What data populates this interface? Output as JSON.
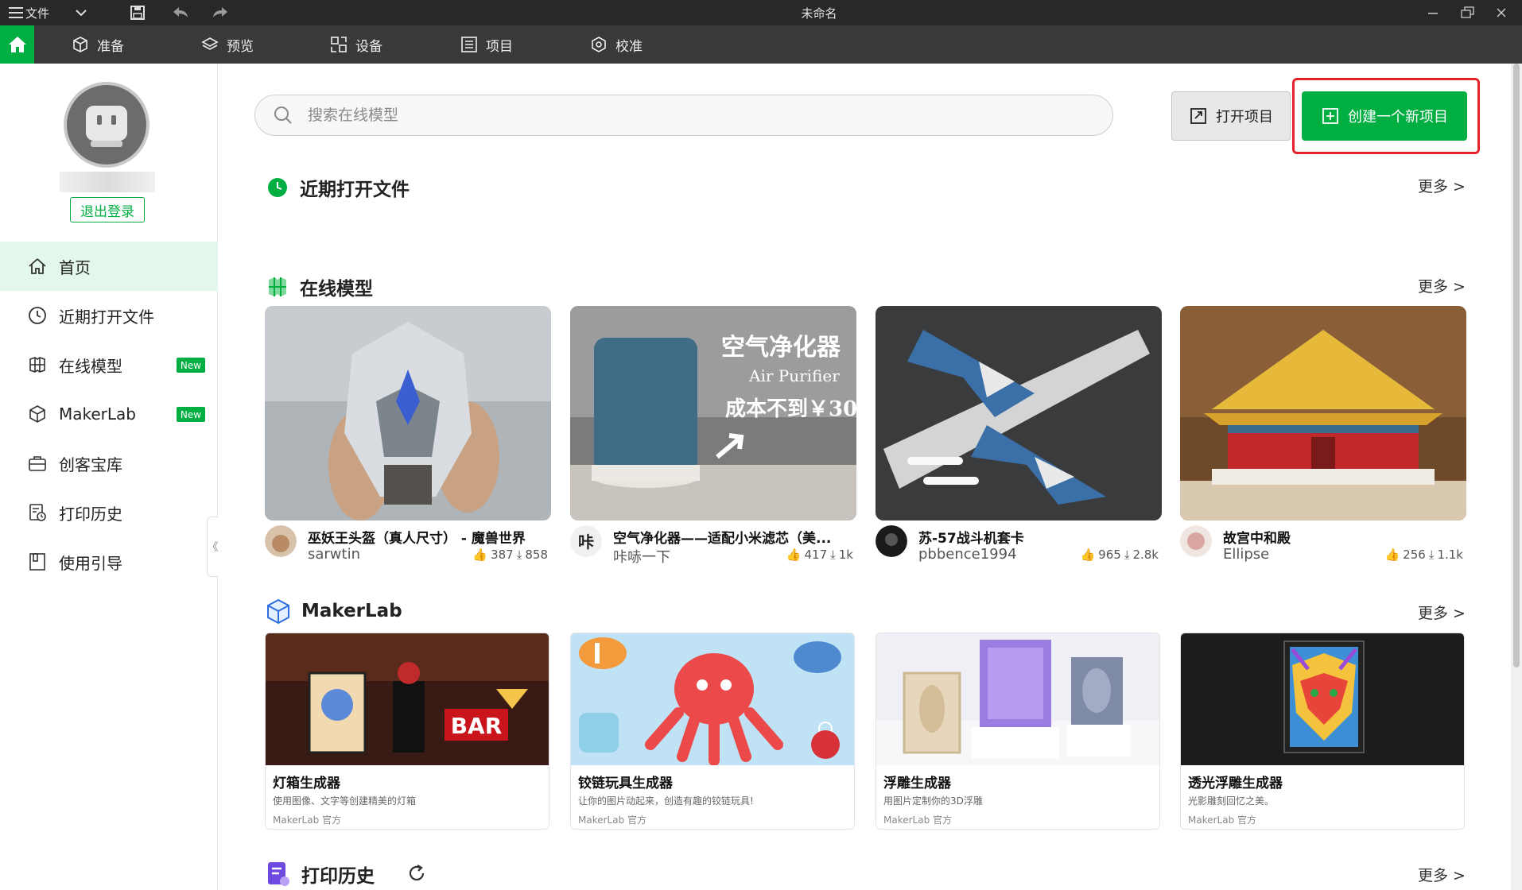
{
  "titlebar": {
    "menu_label": "文件",
    "doc_title": "未命名"
  },
  "tabs": [
    {
      "label": "准备",
      "icon": "cube-icon"
    },
    {
      "label": "预览",
      "icon": "layers-icon"
    },
    {
      "label": "设备",
      "icon": "device-icon"
    },
    {
      "label": "项目",
      "icon": "project-icon"
    },
    {
      "label": "校准",
      "icon": "calibrate-icon"
    }
  ],
  "sidebar": {
    "logout": "退出登录",
    "items": [
      {
        "label": "首页",
        "icon": "home-icon"
      },
      {
        "label": "近期打开文件",
        "icon": "clock-icon"
      },
      {
        "label": "在线模型",
        "icon": "models-icon",
        "badge": "New"
      },
      {
        "label": "MakerLab",
        "icon": "makerlab-icon",
        "badge": "New"
      },
      {
        "label": "创客宝库",
        "icon": "treasure-icon"
      },
      {
        "label": "打印历史",
        "icon": "history-icon"
      },
      {
        "label": "使用引导",
        "icon": "guide-icon"
      }
    ]
  },
  "search": {
    "placeholder": "搜索在线模型"
  },
  "actions": {
    "open_project": "打开项目",
    "new_project": "创建一个新项目"
  },
  "sections": {
    "recent": "近期打开文件",
    "online": "在线模型",
    "makerlab": "MakerLab",
    "history": "打印历史",
    "more": "更多 >"
  },
  "models": [
    {
      "title": "巫妖王头盔（真人尺寸） - 魔兽世界",
      "author": "sarwtin",
      "likes": "387",
      "downloads": "858"
    },
    {
      "title": "空气净化器——适配小米滤芯（美...",
      "author": "咔哧一下",
      "likes": "417",
      "downloads": "1k",
      "img_text1": "空气净化器",
      "img_text2": "Air Purifier",
      "img_text3": "成本不到￥30"
    },
    {
      "title": "苏-57战斗机套卡",
      "author": "pbbence1994",
      "likes": "965",
      "downloads": "2.8k"
    },
    {
      "title": "故宫中和殿",
      "author": "Ellipse",
      "likes": "256",
      "downloads": "1.1k"
    }
  ],
  "makerlab": [
    {
      "title": "灯箱生成器",
      "desc": "使用图像、文字等创建精美的灯箱",
      "owner": "MakerLab 官方",
      "img_text": "BAR"
    },
    {
      "title": "铰链玩具生成器",
      "desc": "让你的图片动起来，创造有趣的铰链玩具!",
      "owner": "MakerLab 官方"
    },
    {
      "title": "浮雕生成器",
      "desc": "用图片定制你的3D浮雕",
      "owner": "MakerLab 官方"
    },
    {
      "title": "透光浮雕生成器",
      "desc": "光影雕刻回忆之美。",
      "owner": "MakerLab 官方"
    }
  ]
}
